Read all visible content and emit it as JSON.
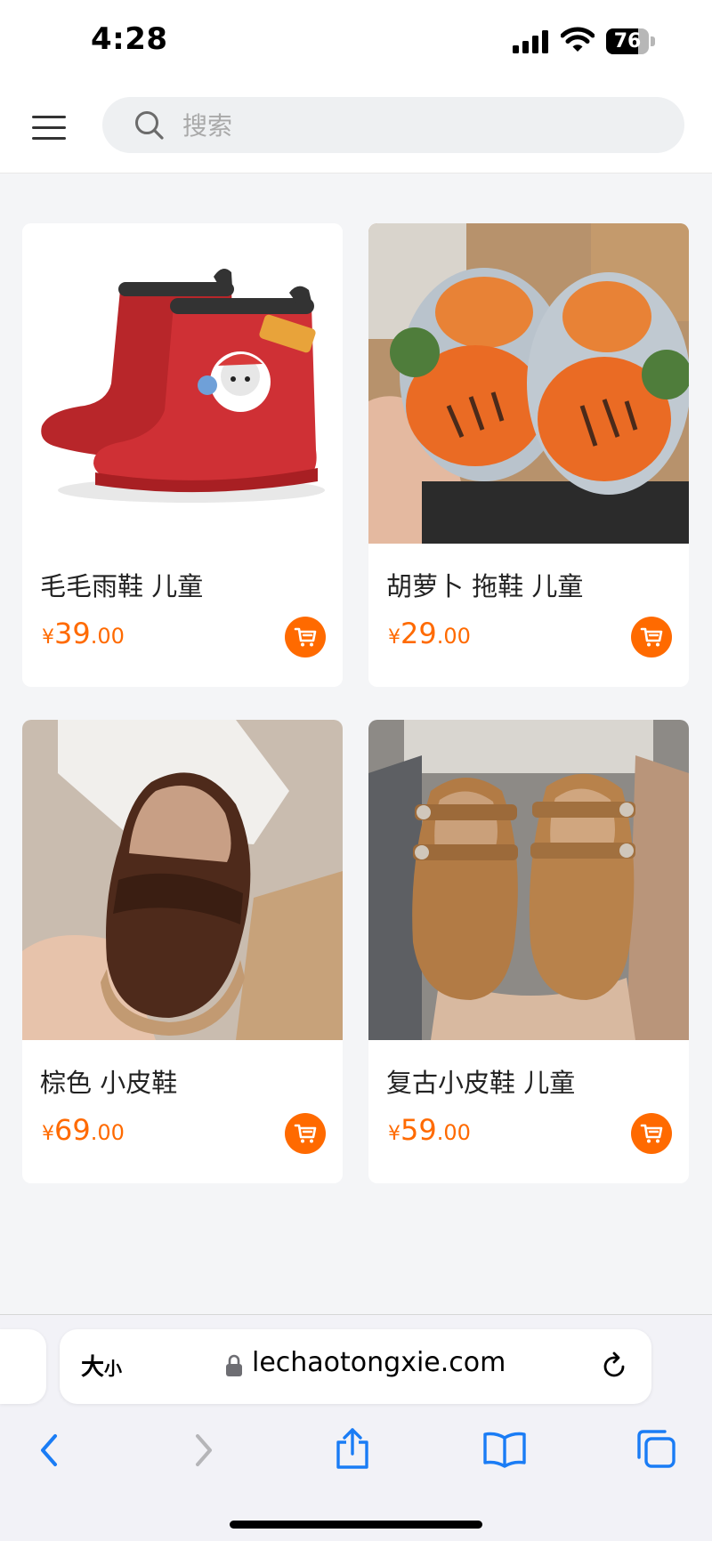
{
  "status_bar": {
    "time": "4:28",
    "battery": "76",
    "battery_level": 0.76
  },
  "header": {
    "search_placeholder": "搜索"
  },
  "products": [
    {
      "title": "毛毛雨鞋 儿童",
      "currency": "¥",
      "price_int": "39",
      "price_dec": ".00",
      "image": "red-rain-boots"
    },
    {
      "title": "胡萝卜 拖鞋 儿童",
      "currency": "¥",
      "price_int": "29",
      "price_dec": ".00",
      "image": "carrot-plush-slippers"
    },
    {
      "title": "棕色 小皮鞋",
      "currency": "¥",
      "price_int": "69",
      "price_dec": ".00",
      "image": "brown-leather-shoe"
    },
    {
      "title": "复古小皮鞋 儿童",
      "currency": "¥",
      "price_int": "59",
      "price_dec": ".00",
      "image": "tan-mary-jane-shoes"
    }
  ],
  "browser": {
    "aa_big": "大",
    "aa_small": "小",
    "url": "lechaotongxie.com"
  },
  "colors": {
    "accent": "#ff6a00",
    "ios_blue": "#1a7cf5"
  },
  "icons": [
    "menu-icon",
    "search-icon",
    "cart-icon",
    "lock-icon",
    "reload-icon",
    "back-icon",
    "forward-icon",
    "share-icon",
    "bookmarks-icon",
    "tabs-icon"
  ]
}
